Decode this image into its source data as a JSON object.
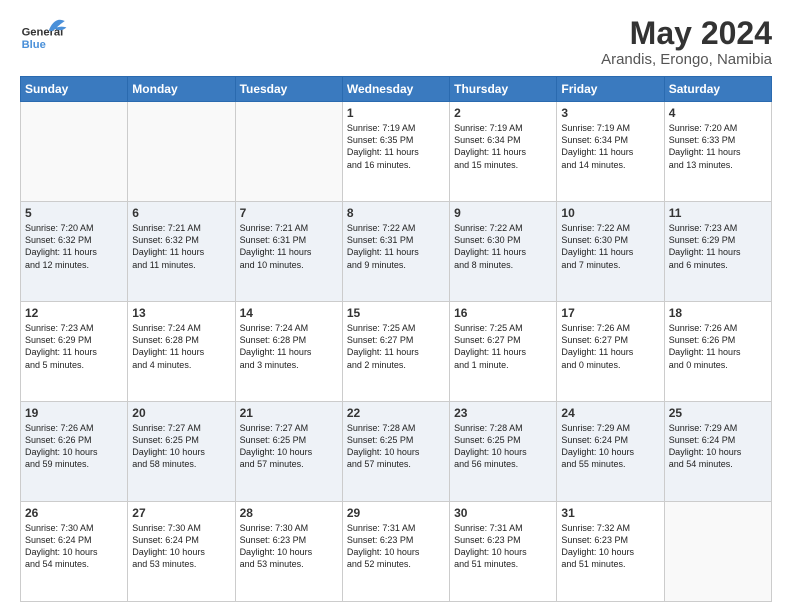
{
  "header": {
    "logo_line1": "General",
    "logo_line2": "Blue",
    "title": "May 2024",
    "subtitle": "Arandis, Erongo, Namibia"
  },
  "days_of_week": [
    "Sunday",
    "Monday",
    "Tuesday",
    "Wednesday",
    "Thursday",
    "Friday",
    "Saturday"
  ],
  "weeks": [
    [
      {
        "day": "",
        "info": ""
      },
      {
        "day": "",
        "info": ""
      },
      {
        "day": "",
        "info": ""
      },
      {
        "day": "1",
        "info": "Sunrise: 7:19 AM\nSunset: 6:35 PM\nDaylight: 11 hours\nand 16 minutes."
      },
      {
        "day": "2",
        "info": "Sunrise: 7:19 AM\nSunset: 6:34 PM\nDaylight: 11 hours\nand 15 minutes."
      },
      {
        "day": "3",
        "info": "Sunrise: 7:19 AM\nSunset: 6:34 PM\nDaylight: 11 hours\nand 14 minutes."
      },
      {
        "day": "4",
        "info": "Sunrise: 7:20 AM\nSunset: 6:33 PM\nDaylight: 11 hours\nand 13 minutes."
      }
    ],
    [
      {
        "day": "5",
        "info": "Sunrise: 7:20 AM\nSunset: 6:32 PM\nDaylight: 11 hours\nand 12 minutes."
      },
      {
        "day": "6",
        "info": "Sunrise: 7:21 AM\nSunset: 6:32 PM\nDaylight: 11 hours\nand 11 minutes."
      },
      {
        "day": "7",
        "info": "Sunrise: 7:21 AM\nSunset: 6:31 PM\nDaylight: 11 hours\nand 10 minutes."
      },
      {
        "day": "8",
        "info": "Sunrise: 7:22 AM\nSunset: 6:31 PM\nDaylight: 11 hours\nand 9 minutes."
      },
      {
        "day": "9",
        "info": "Sunrise: 7:22 AM\nSunset: 6:30 PM\nDaylight: 11 hours\nand 8 minutes."
      },
      {
        "day": "10",
        "info": "Sunrise: 7:22 AM\nSunset: 6:30 PM\nDaylight: 11 hours\nand 7 minutes."
      },
      {
        "day": "11",
        "info": "Sunrise: 7:23 AM\nSunset: 6:29 PM\nDaylight: 11 hours\nand 6 minutes."
      }
    ],
    [
      {
        "day": "12",
        "info": "Sunrise: 7:23 AM\nSunset: 6:29 PM\nDaylight: 11 hours\nand 5 minutes."
      },
      {
        "day": "13",
        "info": "Sunrise: 7:24 AM\nSunset: 6:28 PM\nDaylight: 11 hours\nand 4 minutes."
      },
      {
        "day": "14",
        "info": "Sunrise: 7:24 AM\nSunset: 6:28 PM\nDaylight: 11 hours\nand 3 minutes."
      },
      {
        "day": "15",
        "info": "Sunrise: 7:25 AM\nSunset: 6:27 PM\nDaylight: 11 hours\nand 2 minutes."
      },
      {
        "day": "16",
        "info": "Sunrise: 7:25 AM\nSunset: 6:27 PM\nDaylight: 11 hours\nand 1 minute."
      },
      {
        "day": "17",
        "info": "Sunrise: 7:26 AM\nSunset: 6:27 PM\nDaylight: 11 hours\nand 0 minutes."
      },
      {
        "day": "18",
        "info": "Sunrise: 7:26 AM\nSunset: 6:26 PM\nDaylight: 11 hours\nand 0 minutes."
      }
    ],
    [
      {
        "day": "19",
        "info": "Sunrise: 7:26 AM\nSunset: 6:26 PM\nDaylight: 10 hours\nand 59 minutes."
      },
      {
        "day": "20",
        "info": "Sunrise: 7:27 AM\nSunset: 6:25 PM\nDaylight: 10 hours\nand 58 minutes."
      },
      {
        "day": "21",
        "info": "Sunrise: 7:27 AM\nSunset: 6:25 PM\nDaylight: 10 hours\nand 57 minutes."
      },
      {
        "day": "22",
        "info": "Sunrise: 7:28 AM\nSunset: 6:25 PM\nDaylight: 10 hours\nand 57 minutes."
      },
      {
        "day": "23",
        "info": "Sunrise: 7:28 AM\nSunset: 6:25 PM\nDaylight: 10 hours\nand 56 minutes."
      },
      {
        "day": "24",
        "info": "Sunrise: 7:29 AM\nSunset: 6:24 PM\nDaylight: 10 hours\nand 55 minutes."
      },
      {
        "day": "25",
        "info": "Sunrise: 7:29 AM\nSunset: 6:24 PM\nDaylight: 10 hours\nand 54 minutes."
      }
    ],
    [
      {
        "day": "26",
        "info": "Sunrise: 7:30 AM\nSunset: 6:24 PM\nDaylight: 10 hours\nand 54 minutes."
      },
      {
        "day": "27",
        "info": "Sunrise: 7:30 AM\nSunset: 6:24 PM\nDaylight: 10 hours\nand 53 minutes."
      },
      {
        "day": "28",
        "info": "Sunrise: 7:30 AM\nSunset: 6:23 PM\nDaylight: 10 hours\nand 53 minutes."
      },
      {
        "day": "29",
        "info": "Sunrise: 7:31 AM\nSunset: 6:23 PM\nDaylight: 10 hours\nand 52 minutes."
      },
      {
        "day": "30",
        "info": "Sunrise: 7:31 AM\nSunset: 6:23 PM\nDaylight: 10 hours\nand 51 minutes."
      },
      {
        "day": "31",
        "info": "Sunrise: 7:32 AM\nSunset: 6:23 PM\nDaylight: 10 hours\nand 51 minutes."
      },
      {
        "day": "",
        "info": ""
      }
    ]
  ]
}
